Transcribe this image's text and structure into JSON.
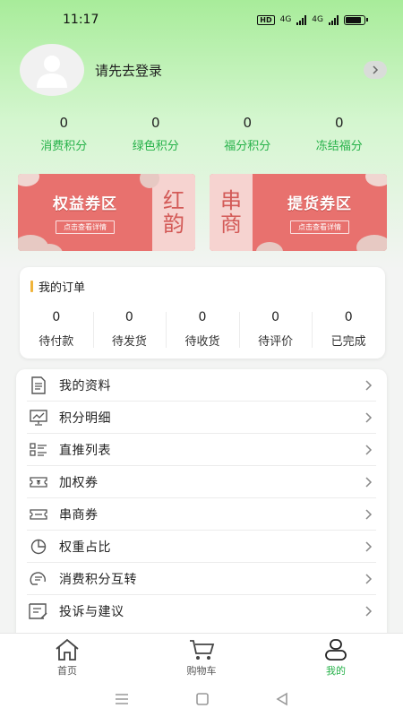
{
  "status_bar": {
    "time": "11:17",
    "hd": "HD",
    "net1": "4G",
    "net2": "4G"
  },
  "profile": {
    "login_text": "请先去登录"
  },
  "points": [
    {
      "value": "0",
      "label": "消费积分"
    },
    {
      "value": "0",
      "label": "绿色积分"
    },
    {
      "value": "0",
      "label": "福分积分"
    },
    {
      "value": "0",
      "label": "冻结福分"
    }
  ],
  "banners": [
    {
      "title": "权益券区",
      "sub": "点击查看详情",
      "side_text": "红韵"
    },
    {
      "title": "提货券区",
      "sub": "点击查看详情",
      "side_text": "串商"
    }
  ],
  "orders": {
    "title": "我的订单",
    "items": [
      {
        "value": "0",
        "label": "待付款"
      },
      {
        "value": "0",
        "label": "待发货"
      },
      {
        "value": "0",
        "label": "待收货"
      },
      {
        "value": "0",
        "label": "待评价"
      },
      {
        "value": "0",
        "label": "已完成"
      }
    ]
  },
  "menu": [
    {
      "label": "我的资料",
      "icon": "document-icon"
    },
    {
      "label": "积分明细",
      "icon": "chart-icon"
    },
    {
      "label": "直推列表",
      "icon": "list-icon"
    },
    {
      "label": "加权券",
      "icon": "ticket-icon"
    },
    {
      "label": "串商券",
      "icon": "coupon-icon"
    },
    {
      "label": "权重占比",
      "icon": "pie-icon"
    },
    {
      "label": "消费积分互转",
      "icon": "exchange-icon"
    },
    {
      "label": "投诉与建议",
      "icon": "feedback-icon"
    }
  ],
  "tabbar": [
    {
      "label": "首页",
      "icon": "home-icon",
      "active": false
    },
    {
      "label": "购物车",
      "icon": "cart-icon",
      "active": false
    },
    {
      "label": "我的",
      "icon": "user-icon",
      "active": true
    }
  ],
  "colors": {
    "accent": "#27b24a",
    "banner_red": "#e8716e",
    "header_green": "#a8ec9a"
  }
}
